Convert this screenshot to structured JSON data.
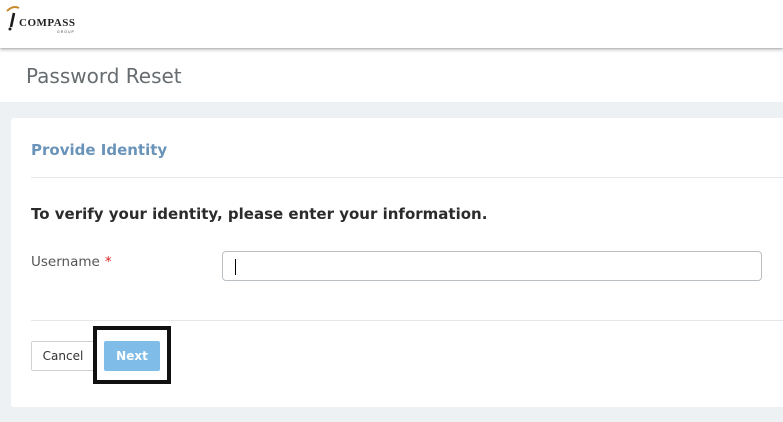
{
  "logo": {
    "name": "COMPASS",
    "sub": "GROUP"
  },
  "page": {
    "title": "Password Reset"
  },
  "card": {
    "title": "Provide Identity",
    "instruction": "To verify your identity, please enter your information."
  },
  "form": {
    "username_label": "Username",
    "required_marker": "*",
    "username_value": ""
  },
  "actions": {
    "cancel_label": "Cancel",
    "next_label": "Next"
  },
  "colors": {
    "accent_title": "#6a93b9",
    "next_button": "#7fbde8",
    "required": "#dd2222",
    "background": "#eef1f4"
  }
}
